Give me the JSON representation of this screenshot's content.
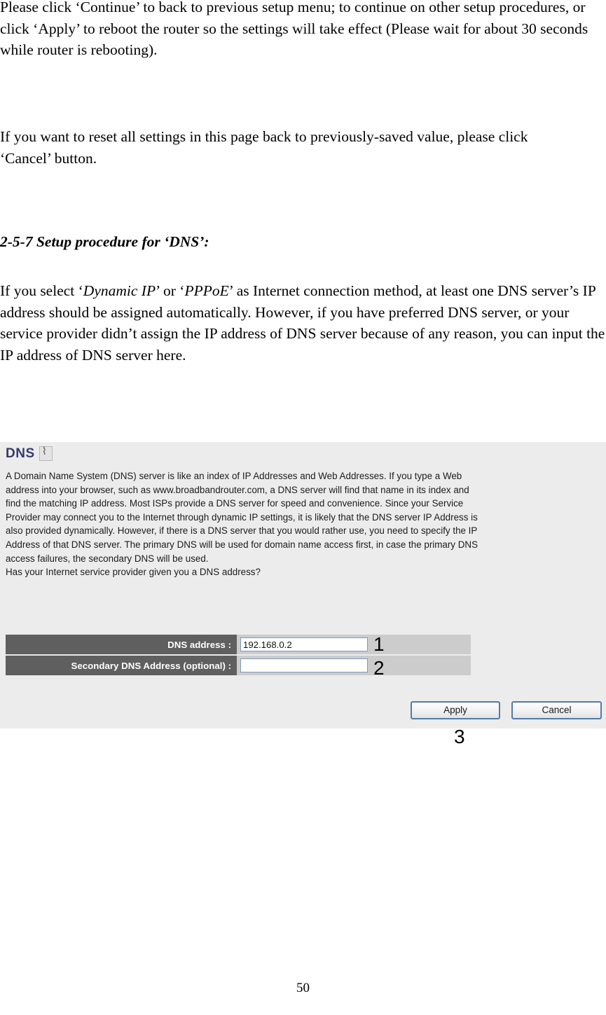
{
  "document": {
    "paragraph_1": "Please click ‘Continue’ to back to previous setup menu; to continue on other setup procedures, or click ‘Apply’ to reboot the router so the settings will take effect (Please wait for about 30 seconds while router is rebooting).",
    "paragraph_2": "If you want to reset all settings in this page back to previously-saved value, please click ‘Cancel’ button.",
    "section_heading": "2-5-7 Setup procedure for ‘DNS’:",
    "paragraph_3_part1": "If you select ‘",
    "paragraph_3_em1": "Dynamic IP",
    "paragraph_3_part2": "’ or ‘",
    "paragraph_3_em2": "PPPoE",
    "paragraph_3_part3": "’ as Internet connection method, at least one DNS server’s IP address should be assigned automatically. However, if you have preferred DNS server, or your service provider didn’t assign the IP address of DNS server because of any reason, you can input the IP address of DNS server here.",
    "page_number": "50"
  },
  "panel": {
    "title": "DNS",
    "title_icon": "broken-image-icon",
    "description": "A Domain Name System (DNS) server is like an index of IP Addresses and Web Addresses. If you type a Web\naddress into your browser, such as www.broadbandrouter.com, a DNS server will find that name in its index and\nfind the matching IP address. Most ISPs provide a DNS server for speed and convenience. Since your Service\nProvider may connect you to the Internet through dynamic IP settings, it is likely that the DNS server IP Address is\nalso provided dynamically. However, if there is a DNS server that you would rather use, you need to specify the IP\nAddress of that DNS server. The primary DNS will be used for domain name access first, in case the primary DNS\naccess failures, the secondary DNS will be used.\nHas your Internet service provider given you a DNS address?",
    "fields": [
      {
        "label": "DNS address :",
        "value": "192.168.0.2",
        "placeholder": ""
      },
      {
        "label": "Secondary DNS Address (optional) :",
        "value": "",
        "placeholder": ""
      }
    ],
    "buttons": {
      "apply": "Apply",
      "cancel": "Cancel"
    },
    "colors": {
      "panel_background": "#ececec",
      "label_cell": "#5f5f5f",
      "value_cell": "#cccccc",
      "title_text": "#363a6e",
      "button_border": "#537ba6",
      "input_border": "#7c9bbd"
    }
  },
  "callouts": {
    "one": "1",
    "two": "2",
    "three": "3"
  }
}
